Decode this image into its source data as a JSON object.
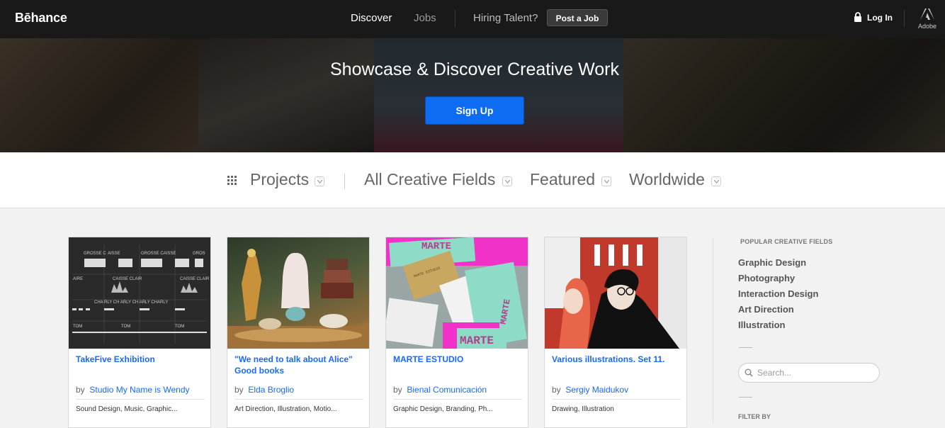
{
  "header": {
    "logo": "Bēhance",
    "nav_discover": "Discover",
    "nav_jobs": "Jobs",
    "hiring": "Hiring Talent?",
    "post_job": "Post a Job",
    "login": "Log In",
    "adobe": "Adobe"
  },
  "hero": {
    "title": "Showcase & Discover Creative Work",
    "signup": "Sign Up"
  },
  "filters": {
    "projects": "Projects",
    "fields": "All Creative Fields",
    "featured": "Featured",
    "worldwide": "Worldwide"
  },
  "cards": [
    {
      "title": "TakeFive Exhibition",
      "by": "by",
      "owner": "Studio My Name is Wendy",
      "fields": "Sound Design, Music, Graphic..."
    },
    {
      "title": "\"We need to talk about Alice\" Good books",
      "by": "by",
      "owner": "Elda Broglio",
      "fields": "Art Direction, Illustration, Motio..."
    },
    {
      "title": "MARTE ESTUDIO",
      "by": "by",
      "owner": "Bienal Comunicación",
      "fields": "Graphic Design, Branding, Ph..."
    },
    {
      "title": "Various illustrations. Set 11.",
      "by": "by",
      "owner": "Sergiy Maidukov",
      "fields": "Drawing, Illustration"
    }
  ],
  "card_art": {
    "takefive": {
      "tl": "GROSSE C",
      "tl2": "AISSE",
      "tr": "GROSSE CAISSE",
      "tr2": "GROS",
      "row2a": "AIRE",
      "row2b": "CAISSE CLAIR",
      "row2c": "CAISSE CLAIR",
      "row3": "CHA  RLY  CH  ARLY  CH  ARLY CHARLY",
      "row4a": "TOM",
      "row4b": "TOM",
      "row4c": "TOM"
    },
    "marte": {
      "brand": "MARTE",
      "brand2": "MARTE ESTUDIO"
    }
  },
  "sidebar": {
    "heading": "POPULAR CREATIVE FIELDS",
    "links": [
      "Graphic Design",
      "Photography",
      "Interaction Design",
      "Art Direction",
      "Illustration"
    ],
    "search_placeholder": "Search...",
    "filter_by": "FILTER BY"
  },
  "colors": {
    "accent": "#1769ff",
    "signup": "#0d6cf2",
    "topbar": "#191919"
  },
  "icons": [
    "lock-icon",
    "adobe-icon",
    "grid-icon",
    "chevron-down-icon",
    "search-icon"
  ]
}
